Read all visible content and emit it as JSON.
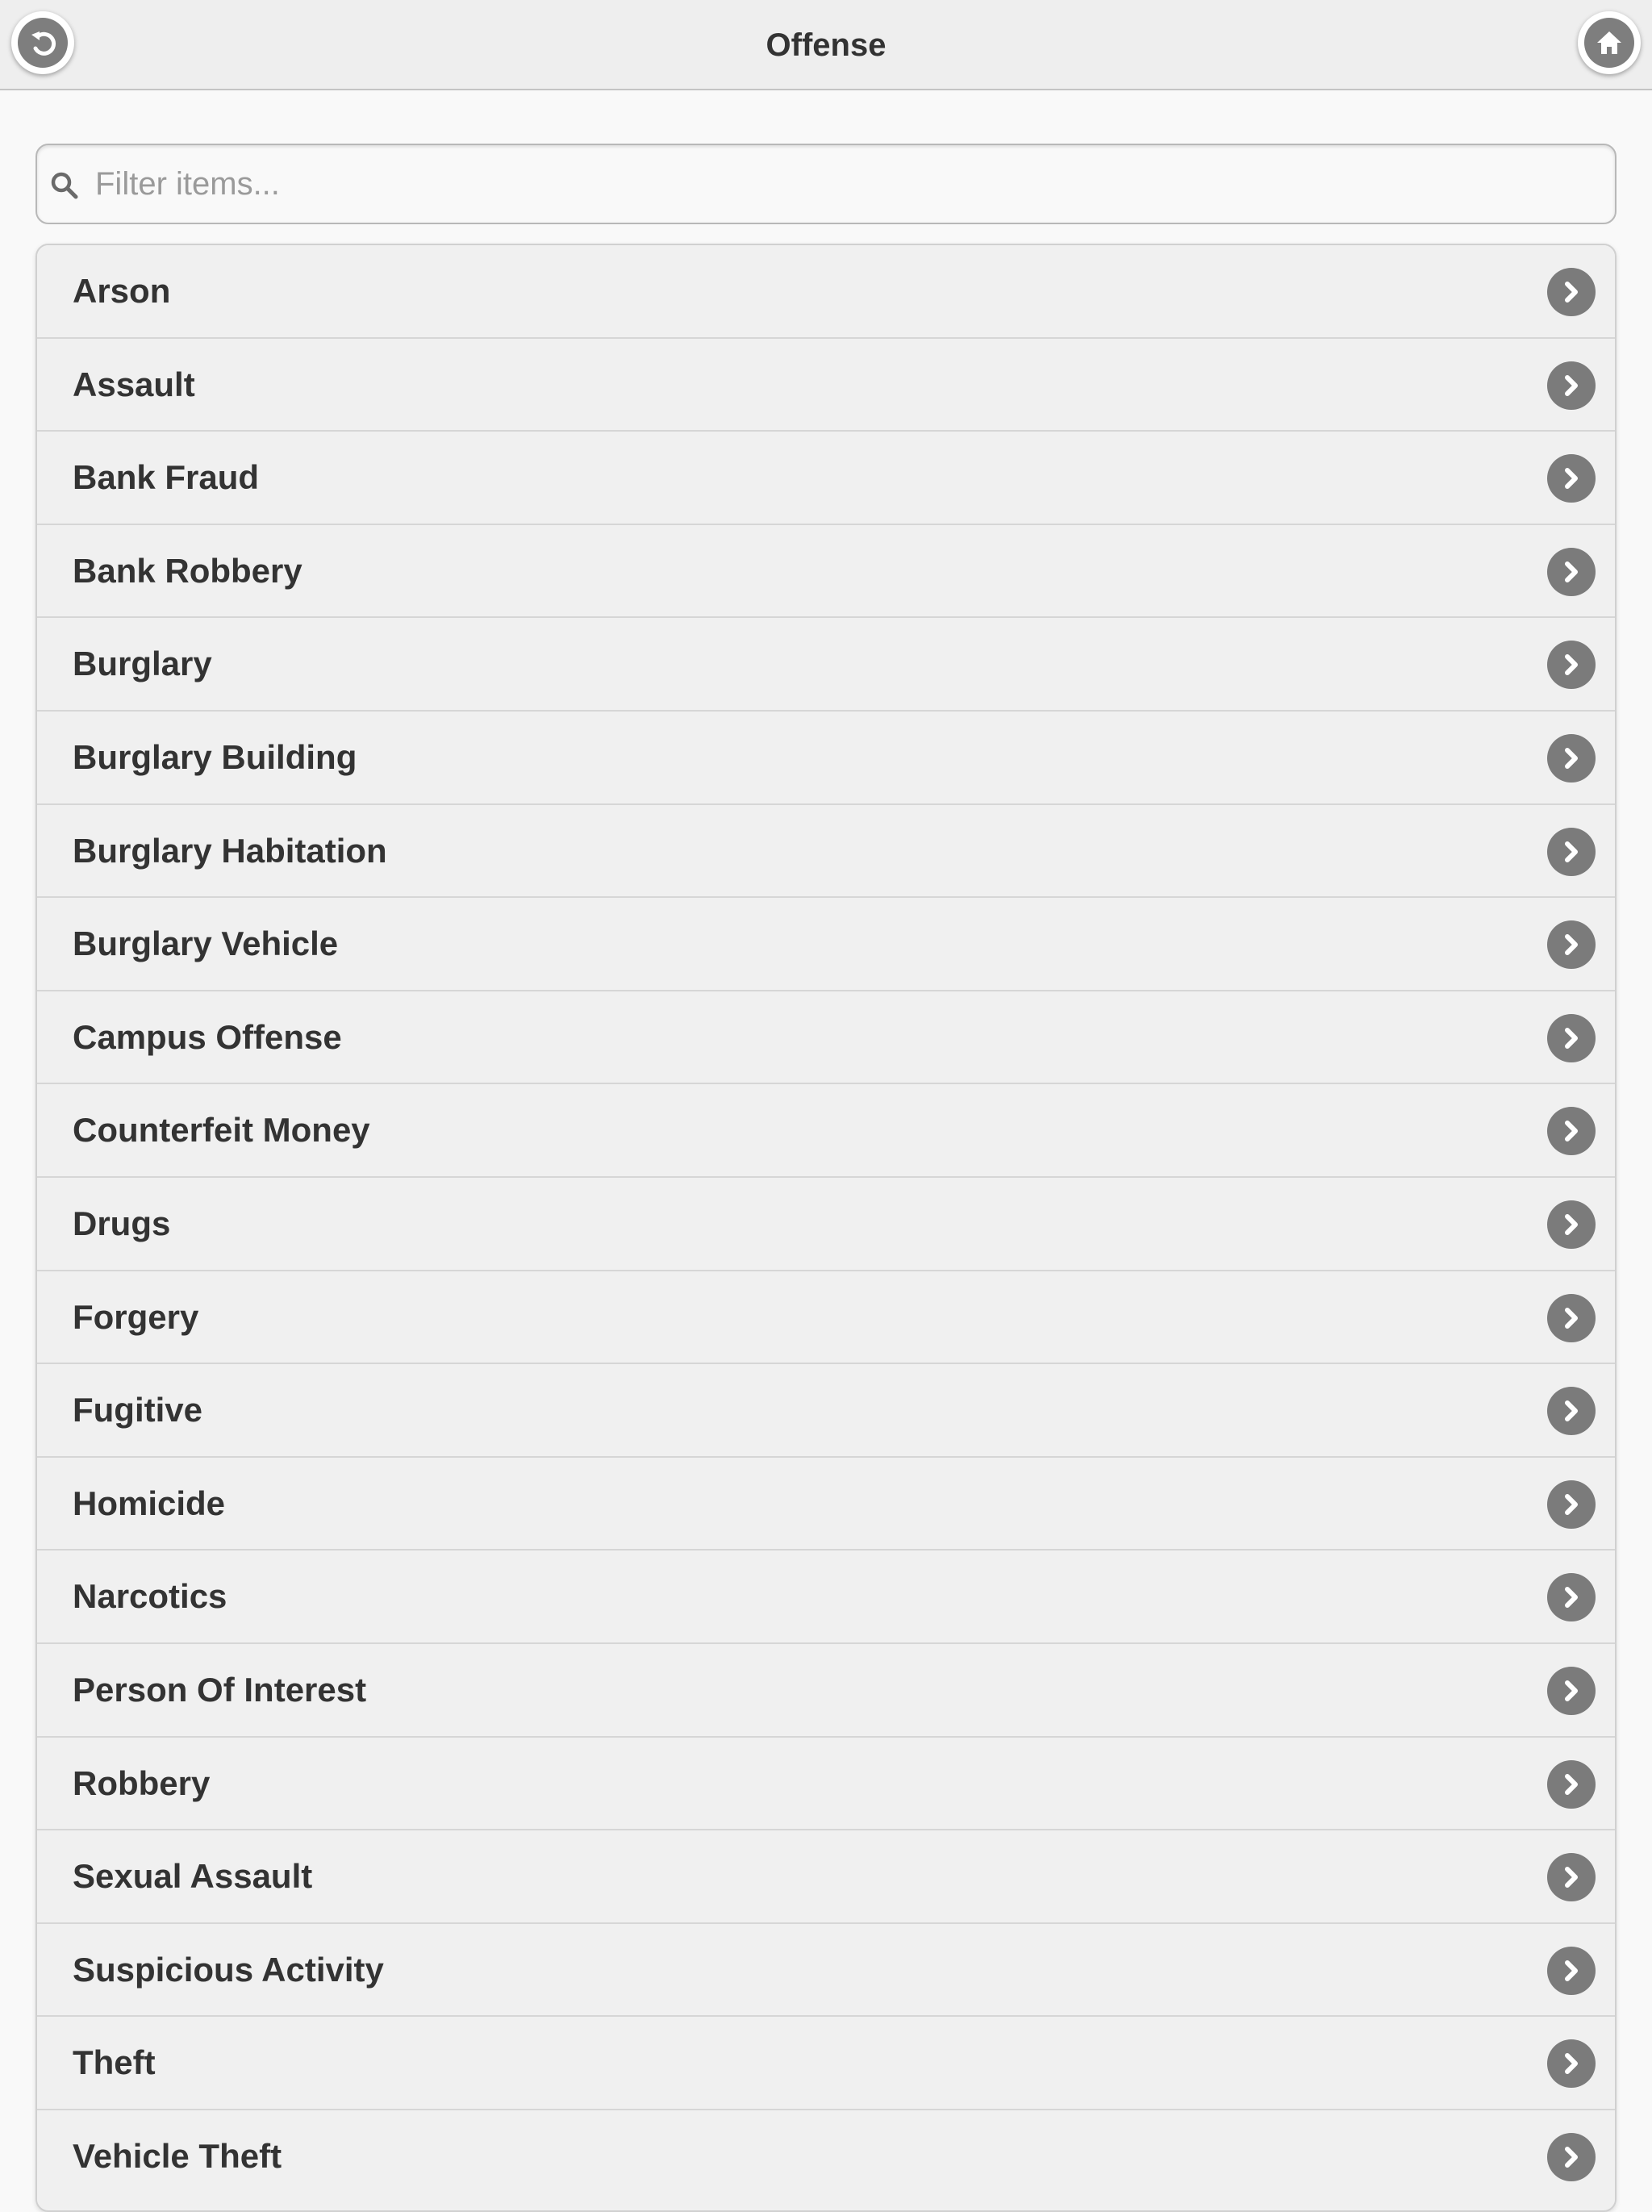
{
  "header": {
    "title": "Offense",
    "back_icon": "back-arrow-icon",
    "home_icon": "home-icon"
  },
  "search": {
    "placeholder": "Filter items...",
    "value": "",
    "icon": "search-icon"
  },
  "list": {
    "item_icon": "chevron-right-icon",
    "items": [
      {
        "label": "Arson"
      },
      {
        "label": "Assault"
      },
      {
        "label": "Bank Fraud"
      },
      {
        "label": "Bank Robbery"
      },
      {
        "label": "Burglary"
      },
      {
        "label": "Burglary Building"
      },
      {
        "label": "Burglary Habitation"
      },
      {
        "label": "Burglary Vehicle"
      },
      {
        "label": "Campus Offense"
      },
      {
        "label": "Counterfeit Money"
      },
      {
        "label": "Drugs"
      },
      {
        "label": "Forgery"
      },
      {
        "label": "Fugitive"
      },
      {
        "label": "Homicide"
      },
      {
        "label": "Narcotics"
      },
      {
        "label": "Person Of Interest"
      },
      {
        "label": "Robbery"
      },
      {
        "label": "Sexual Assault"
      },
      {
        "label": "Suspicious Activity"
      },
      {
        "label": "Theft"
      },
      {
        "label": "Vehicle Theft"
      }
    ]
  },
  "colors": {
    "header_bg": "#eeeeee",
    "page_bg": "#f9f9f9",
    "item_bg": "#f0f0f0",
    "text": "#333333",
    "icon_disc": "#7b7b7b"
  }
}
